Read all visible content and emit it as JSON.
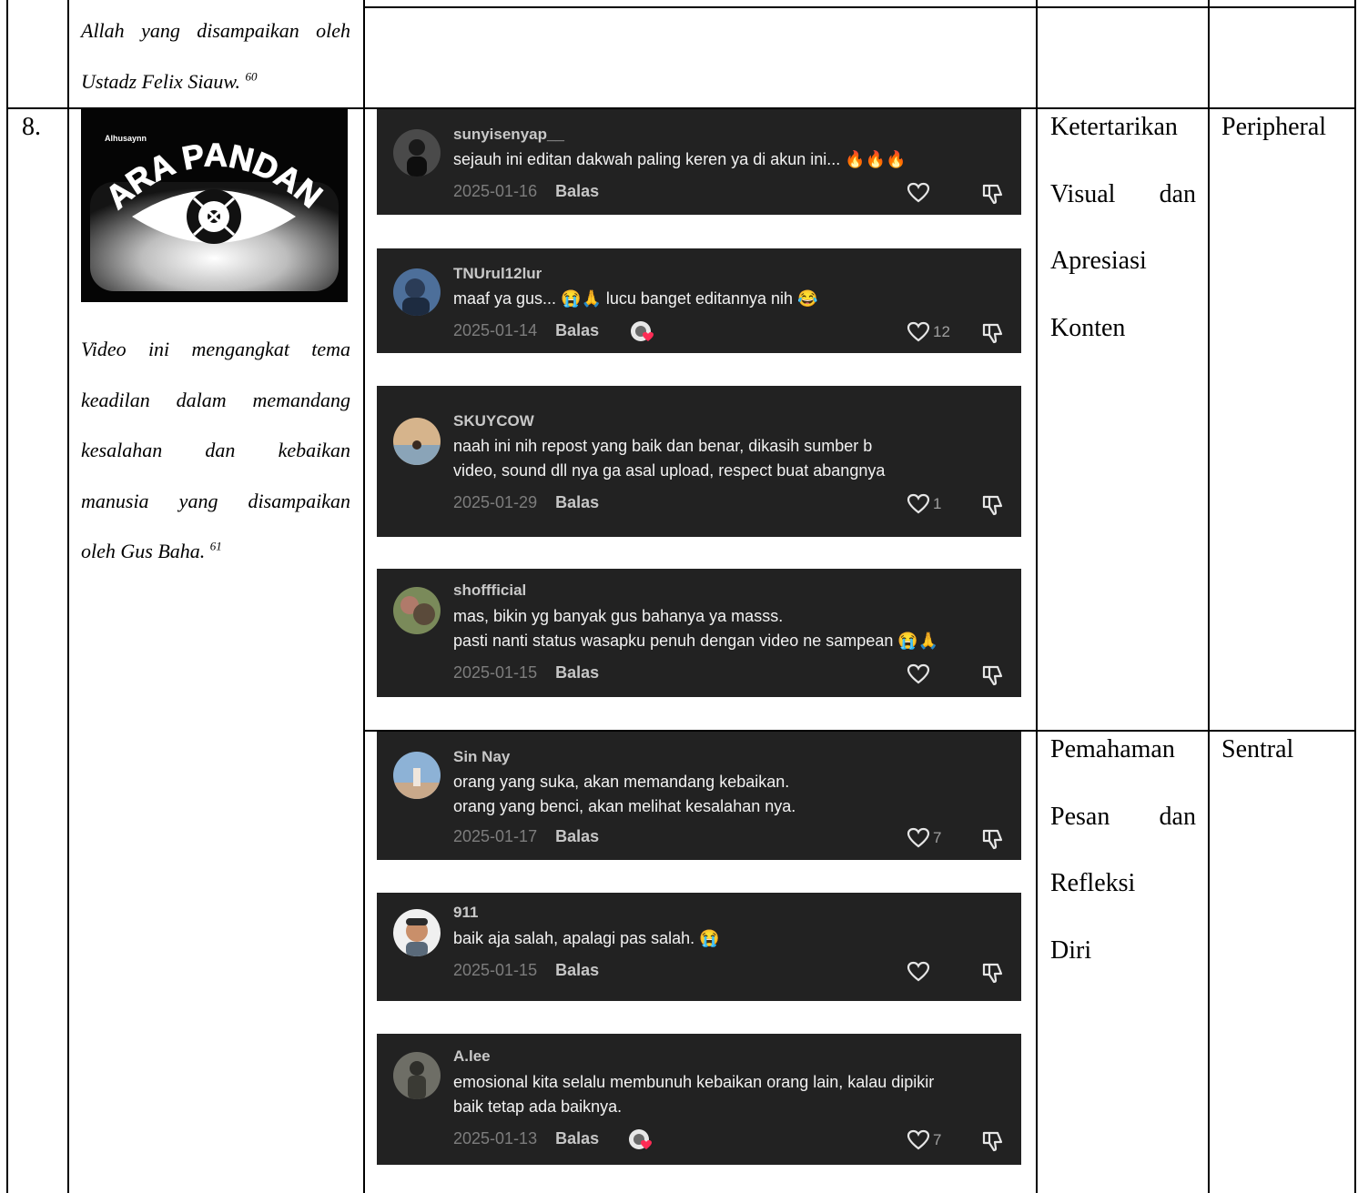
{
  "prev_row": {
    "content_lines": [
      "Allah yang disampaikan oleh",
      "Ustadz Felix Siauw."
    ],
    "footnote": "60"
  },
  "row8": {
    "number": "8.",
    "thumbnail": {
      "channel": "Alhusaynn",
      "title": "CARA PANDANG"
    },
    "description_lines": [
      "Video ini mengangkat tema",
      "keadilan dalam memandang",
      "kesalahan dan kebaikan",
      "manusia yang disampaikan",
      "oleh Gus Baha."
    ],
    "footnote": "61",
    "groups": [
      {
        "category_lines": [
          "Ketertarikan",
          "Visual dan",
          "Apresiasi",
          "Konten"
        ],
        "route": "Peripheral",
        "comments": [
          {
            "user": "sunyisenyap__",
            "lines": [
              "sejauh ini editan dakwah paling keren ya di akun ini... 🔥🔥🔥"
            ],
            "date": "2025-01-16",
            "reply": "Balas",
            "likes": "",
            "liked_by_creator": false,
            "avatar_color": "#4a4a4a"
          },
          {
            "user": "TNUrul12lur",
            "lines": [
              "maaf ya gus... 😭🙏 lucu banget editannya nih 😂"
            ],
            "date": "2025-01-14",
            "reply": "Balas",
            "likes": "12",
            "liked_by_creator": true,
            "avatar_color": "#3a5a8a"
          },
          {
            "user": "SKUYCOW",
            "lines": [
              "naah ini nih repost yang baik dan benar, dikasih sumber b",
              "video, sound dll nya ga asal upload, respect buat abangnya"
            ],
            "date": "2025-01-29",
            "reply": "Balas",
            "likes": "1",
            "liked_by_creator": false,
            "avatar_color": "#c7a37a"
          },
          {
            "user": "shoffficial",
            "lines": [
              "mas, bikin yg banyak gus bahanya ya masss.",
              "pasti nanti status wasapku penuh dengan video ne sampean 😭🙏"
            ],
            "date": "2025-01-15",
            "reply": "Balas",
            "likes": "",
            "liked_by_creator": false,
            "avatar_color": "#8a6a5a"
          }
        ]
      },
      {
        "category_lines": [
          "Pemahaman",
          "Pesan dan",
          "Refleksi",
          "Diri"
        ],
        "route": "Sentral",
        "comments": [
          {
            "user": "Sin Nay",
            "lines": [
              "orang yang suka, akan memandang kebaikan.",
              "orang yang benci, akan melihat kesalahan nya."
            ],
            "date": "2025-01-17",
            "reply": "Balas",
            "likes": "7",
            "liked_by_creator": false,
            "avatar_color": "#8db2d6"
          },
          {
            "user": "911",
            "lines": [
              "baik aja salah, apalagi pas salah. 😭"
            ],
            "date": "2025-01-15",
            "reply": "Balas",
            "likes": "",
            "liked_by_creator": false,
            "avatar_color": "#f0f0f0"
          },
          {
            "user": "A.lee",
            "lines": [
              "emosional kita selalu membunuh kebaikan orang lain, kalau dipikir",
              "baik tetap ada baiknya."
            ],
            "date": "2025-01-13",
            "reply": "Balas",
            "likes": "7",
            "liked_by_creator": true,
            "avatar_color": "#5a5a52"
          }
        ]
      }
    ]
  },
  "colors": {
    "card_bg": "#222222",
    "username": "#c8c8c8",
    "date": "#7d7d7d",
    "reply": "#c6c6c6",
    "rule": "#000000"
  }
}
